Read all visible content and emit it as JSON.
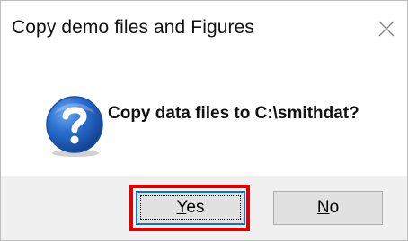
{
  "window": {
    "title": "Copy demo files and Figures",
    "close_icon": "close-icon"
  },
  "message": {
    "icon": "question-icon",
    "text": "Copy data files to C:\\smithdat?"
  },
  "buttons": {
    "yes_mnemonic": "Y",
    "yes_rest": "es",
    "no_mnemonic": "N",
    "no_rest": "o"
  },
  "colors": {
    "highlight": "#e00000",
    "icon_blue": "#1f5fbf",
    "focus_border": "#0078d7"
  }
}
